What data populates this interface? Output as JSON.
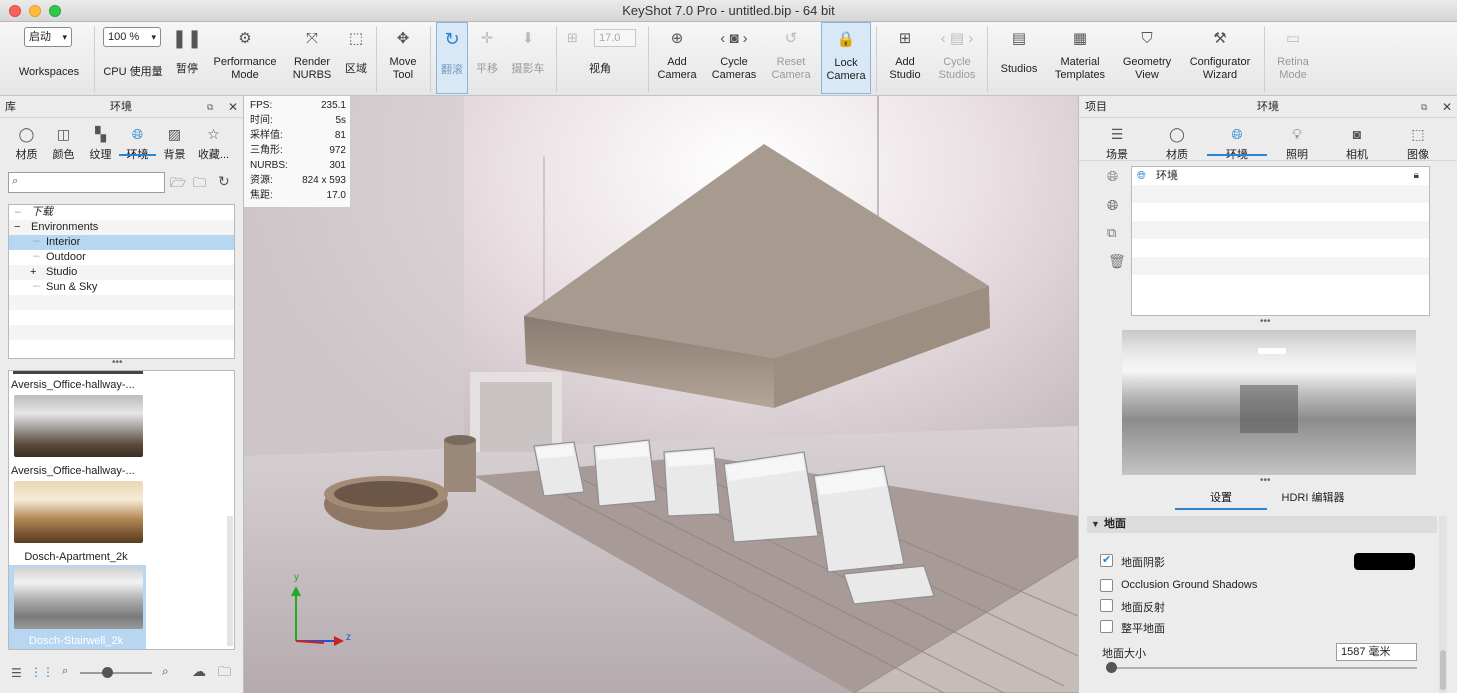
{
  "window": {
    "title": "KeyShot 7.0 Pro  - untitled.bip  - 64 bit"
  },
  "toolbar": {
    "workspaces_select": "启动",
    "workspaces": "Workspaces",
    "cpu_select": "100 %",
    "cpu": "CPU 使用量",
    "pause": "暂停",
    "performance_mode": [
      "Performance",
      "Mode"
    ],
    "render_nurbs": [
      "Render",
      "NURBS"
    ],
    "region": "区域",
    "move_tool": [
      "Move",
      "Tool"
    ],
    "tumble": "翻滚",
    "pan": "平移",
    "dolly": "摄影车",
    "fov_value": "17.0",
    "fov": "视角",
    "add_camera": [
      "Add",
      "Camera"
    ],
    "cycle_cameras": [
      "Cycle",
      "Cameras"
    ],
    "reset_camera": [
      "Reset",
      "Camera"
    ],
    "lock_camera": [
      "Lock",
      "Camera"
    ],
    "add_studio": [
      "Add",
      "Studio"
    ],
    "cycle_studios": [
      "Cycle",
      "Studios"
    ],
    "studios": "Studios",
    "material_templates": [
      "Material",
      "Templates"
    ],
    "geometry_view": [
      "Geometry",
      "View"
    ],
    "configurator_wizard": [
      "Configurator",
      "Wizard"
    ],
    "retina_mode": [
      "Retina",
      "Mode"
    ]
  },
  "library": {
    "title": "库",
    "subtitle": "环境",
    "tabs": [
      {
        "label": "材质",
        "icon": "sphere-icon"
      },
      {
        "label": "颜色",
        "icon": "color-swatch-icon"
      },
      {
        "label": "纹理",
        "icon": "texture-icon"
      },
      {
        "label": "环境",
        "icon": "globe-icon",
        "active": true
      },
      {
        "label": "背景",
        "icon": "image-icon"
      },
      {
        "label": "收藏...",
        "icon": "star-icon"
      }
    ],
    "search_placeholder": "",
    "tree": [
      {
        "label": "下载",
        "level": 0,
        "italic": true
      },
      {
        "label": "Environments",
        "level": 0,
        "expander": "−"
      },
      {
        "label": "Interior",
        "level": 1,
        "selected": true
      },
      {
        "label": "Outdoor",
        "level": 1
      },
      {
        "label": "Studio",
        "level": 1,
        "expander": "+"
      },
      {
        "label": "Sun & Sky",
        "level": 1
      }
    ],
    "thumbnails": [
      {
        "label": "Aversis_Office-hallway-..."
      },
      {
        "label": "Aversis_Office-hallway-..."
      },
      {
        "label": "Dosch-Apartment_2k"
      },
      {
        "label": "Dosch-Stairwell_2k",
        "selected": true
      }
    ]
  },
  "viewport": {
    "stats": [
      {
        "k": "FPS:",
        "v": "235.1"
      },
      {
        "k": "时间:",
        "v": "5s"
      },
      {
        "k": "采样值:",
        "v": "81"
      },
      {
        "k": "三角形:",
        "v": "972"
      },
      {
        "k": "NURBS:",
        "v": "301"
      },
      {
        "k": "资源:",
        "v": "824 x 593"
      },
      {
        "k": "焦距:",
        "v": "17.0"
      }
    ],
    "axis_y": "y",
    "axis_z": "z"
  },
  "project": {
    "title": "项目",
    "subtitle": "环境",
    "tabs": [
      {
        "label": "场景",
        "icon": "scene-list-icon"
      },
      {
        "label": "材质",
        "icon": "sphere-icon"
      },
      {
        "label": "环境",
        "icon": "globe-icon",
        "active": true
      },
      {
        "label": "照明",
        "icon": "bulb-icon"
      },
      {
        "label": "相机",
        "icon": "camera-icon"
      },
      {
        "label": "图像",
        "icon": "image-frame-icon"
      }
    ],
    "env_list": [
      {
        "label": "环境",
        "locked": true
      }
    ],
    "subtabs": [
      {
        "label": "设置",
        "active": true
      },
      {
        "label": "HDRI 编辑器"
      }
    ],
    "ground_section": "地面",
    "ground_shadows": {
      "label": "地面阴影",
      "checked": true,
      "color": "#000000"
    },
    "occlusion": {
      "label": "Occlusion Ground Shadows",
      "checked": false
    },
    "reflections": {
      "label": "地面反射",
      "checked": false
    },
    "flatten": {
      "label": "整平地面",
      "checked": false
    },
    "ground_size": {
      "label": "地面大小",
      "value": "1587 毫米"
    }
  }
}
